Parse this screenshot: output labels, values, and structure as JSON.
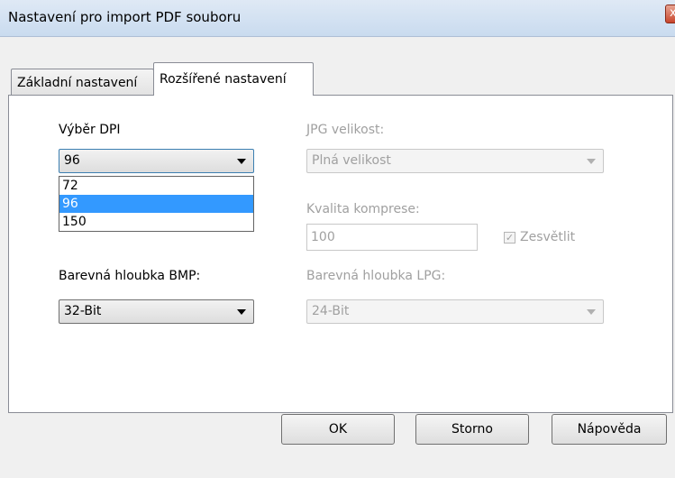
{
  "window": {
    "title": "Nastavení pro import PDF souboru",
    "close_glyph": "x"
  },
  "tabs": [
    {
      "label": "Základní nastavení",
      "active": false
    },
    {
      "label": "Rozšířené nastavení",
      "active": true
    }
  ],
  "dpi": {
    "label": "Výběr DPI",
    "value": "96",
    "options": [
      "72",
      "96",
      "150"
    ],
    "highlighted": "96"
  },
  "bmp_depth": {
    "label": "Barevná hloubka BMP:",
    "value": "32-Bit"
  },
  "jpg_size": {
    "label": "JPG velikost:",
    "value": "Plná velikost",
    "enabled": false
  },
  "compression": {
    "label": "Kvalita komprese:",
    "value": "100",
    "enabled": false
  },
  "brighten": {
    "label": "Zesvětlit",
    "checked": true,
    "enabled": false,
    "check_glyph": "✓"
  },
  "jpg_depth": {
    "label": "Barevná hloubka LPG:",
    "value": "24-Bit",
    "enabled": false
  },
  "buttons": {
    "ok": "OK",
    "cancel": "Storno",
    "help": "Nápověda"
  },
  "colors": {
    "selection": "#3399ff",
    "disabled_text": "#a0a0a0",
    "titlebar": "#dfe9f5"
  }
}
